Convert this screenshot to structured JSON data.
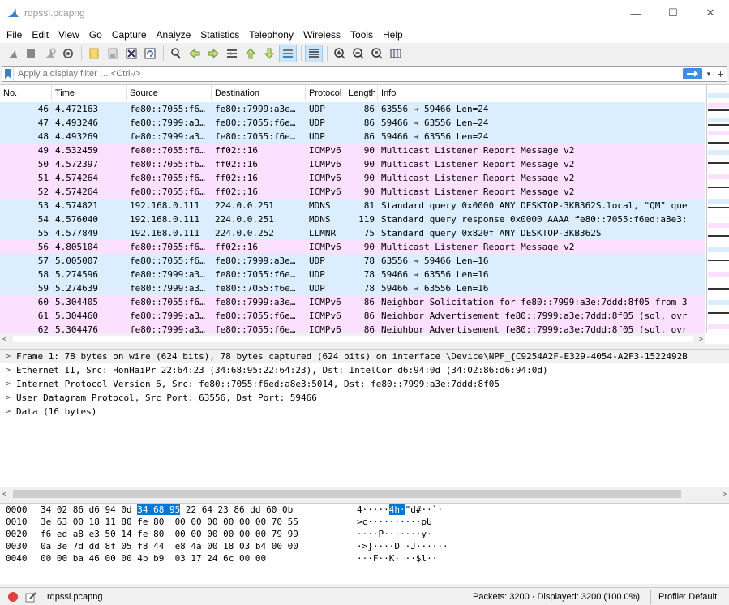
{
  "window": {
    "title": "rdpssl.pcapng",
    "min_glyph": "—",
    "max_glyph": "☐",
    "close_glyph": "✕",
    "icon": "shark-fin-icon"
  },
  "menu": [
    "File",
    "Edit",
    "View",
    "Go",
    "Capture",
    "Analyze",
    "Statistics",
    "Telephony",
    "Wireless",
    "Tools",
    "Help"
  ],
  "filter": {
    "placeholder": "Apply a display filter … <Ctrl-/>",
    "dropdown_glyph": "▾",
    "plus_glyph": "+"
  },
  "packet_list": {
    "columns": [
      "No.",
      "Time",
      "Source",
      "Destination",
      "Protocol",
      "Length",
      "Info"
    ],
    "rows": [
      {
        "no": "46",
        "time": "4.472163",
        "src": "fe80::7055:f6…",
        "dst": "fe80::7999:a3e…",
        "proto": "UDP",
        "len": "86",
        "info": "63556 → 59466 Len=24",
        "kind": "udp"
      },
      {
        "no": "47",
        "time": "4.493246",
        "src": "fe80::7999:a3…",
        "dst": "fe80::7055:f6e…",
        "proto": "UDP",
        "len": "86",
        "info": "59466 → 63556 Len=24",
        "kind": "udp"
      },
      {
        "no": "48",
        "time": "4.493269",
        "src": "fe80::7999:a3…",
        "dst": "fe80::7055:f6e…",
        "proto": "UDP",
        "len": "86",
        "info": "59466 → 63556 Len=24",
        "kind": "udp"
      },
      {
        "no": "49",
        "time": "4.532459",
        "src": "fe80::7055:f6…",
        "dst": "ff02::16",
        "proto": "ICMPv6",
        "len": "90",
        "info": "Multicast Listener Report Message v2",
        "kind": "icmp"
      },
      {
        "no": "50",
        "time": "4.572397",
        "src": "fe80::7055:f6…",
        "dst": "ff02::16",
        "proto": "ICMPv6",
        "len": "90",
        "info": "Multicast Listener Report Message v2",
        "kind": "icmp"
      },
      {
        "no": "51",
        "time": "4.574264",
        "src": "fe80::7055:f6…",
        "dst": "ff02::16",
        "proto": "ICMPv6",
        "len": "90",
        "info": "Multicast Listener Report Message v2",
        "kind": "icmp"
      },
      {
        "no": "52",
        "time": "4.574264",
        "src": "fe80::7055:f6…",
        "dst": "ff02::16",
        "proto": "ICMPv6",
        "len": "90",
        "info": "Multicast Listener Report Message v2",
        "kind": "icmp"
      },
      {
        "no": "53",
        "time": "4.574821",
        "src": "192.168.0.111",
        "dst": "224.0.0.251",
        "proto": "MDNS",
        "len": "81",
        "info": "Standard query 0x0000 ANY DESKTOP-3KB362S.local, \"QM\" que",
        "kind": "udp"
      },
      {
        "no": "54",
        "time": "4.576040",
        "src": "192.168.0.111",
        "dst": "224.0.0.251",
        "proto": "MDNS",
        "len": "119",
        "info": "Standard query response 0x0000 AAAA fe80::7055:f6ed:a8e3:",
        "kind": "udp"
      },
      {
        "no": "55",
        "time": "4.577849",
        "src": "192.168.0.111",
        "dst": "224.0.0.252",
        "proto": "LLMNR",
        "len": "75",
        "info": "Standard query 0x820f ANY DESKTOP-3KB362S",
        "kind": "udp"
      },
      {
        "no": "56",
        "time": "4.805104",
        "src": "fe80::7055:f6…",
        "dst": "ff02::16",
        "proto": "ICMPv6",
        "len": "90",
        "info": "Multicast Listener Report Message v2",
        "kind": "icmp"
      },
      {
        "no": "57",
        "time": "5.005007",
        "src": "fe80::7055:f6…",
        "dst": "fe80::7999:a3e…",
        "proto": "UDP",
        "len": "78",
        "info": "63556 → 59466 Len=16",
        "kind": "udp"
      },
      {
        "no": "58",
        "time": "5.274596",
        "src": "fe80::7999:a3…",
        "dst": "fe80::7055:f6e…",
        "proto": "UDP",
        "len": "78",
        "info": "59466 → 63556 Len=16",
        "kind": "udp"
      },
      {
        "no": "59",
        "time": "5.274639",
        "src": "fe80::7999:a3…",
        "dst": "fe80::7055:f6e…",
        "proto": "UDP",
        "len": "78",
        "info": "59466 → 63556 Len=16",
        "kind": "udp"
      },
      {
        "no": "60",
        "time": "5.304405",
        "src": "fe80::7055:f6…",
        "dst": "fe80::7999:a3e…",
        "proto": "ICMPv6",
        "len": "86",
        "info": "Neighbor Solicitation for fe80::7999:a3e:7ddd:8f05 from 3",
        "kind": "icmp"
      },
      {
        "no": "61",
        "time": "5.304460",
        "src": "fe80::7999:a3…",
        "dst": "fe80::7055:f6e…",
        "proto": "ICMPv6",
        "len": "86",
        "info": "Neighbor Advertisement fe80::7999:a3e:7ddd:8f05 (sol, ovr",
        "kind": "icmp"
      },
      {
        "no": "62",
        "time": "5.304476",
        "src": "fe80::7999:a3…",
        "dst": "fe80::7055:f6e…",
        "proto": "ICMPv6",
        "len": "86",
        "info": "Neighbor Advertisement fe80::7999:a3e:7ddd:8f05 (sol, ovr",
        "kind": "icmp"
      }
    ],
    "scroll_left": "<",
    "scroll_right": ">"
  },
  "details": {
    "expander_glyph": ">",
    "lines": [
      "Frame 1: 78 bytes on wire (624 bits), 78 bytes captured (624 bits) on interface \\Device\\NPF_{C9254A2F-E329-4054-A2F3-1522492B",
      "Ethernet II, Src: HonHaiPr_22:64:23 (34:68:95:22:64:23), Dst: IntelCor_d6:94:0d (34:02:86:d6:94:0d)",
      "Internet Protocol Version 6, Src: fe80::7055:f6ed:a8e3:5014, Dst: fe80::7999:a3e:7ddd:8f05",
      "User Datagram Protocol, Src Port: 63556, Dst Port: 59466",
      "Data (16 bytes)"
    ],
    "scroll_left": "<",
    "scroll_right": ">"
  },
  "bytes": {
    "lines": [
      {
        "off": "0000",
        "hex_pre": "34 02 86 d6 94 0d ",
        "hex_hl": "34 68 95",
        "hex_post": " 22 64 23 86 dd 60 0b",
        "asc_pre": "4·····",
        "asc_hl": "4h·",
        "asc_post": "\"d#··`·"
      },
      {
        "off": "0010",
        "hex_pre": "3e 63 00 18 11 80 fe 80  00 00 00 00 00 00 70 55",
        "hex_hl": "",
        "hex_post": "",
        "asc_pre": ">c··········pU",
        "asc_hl": "",
        "asc_post": ""
      },
      {
        "off": "0020",
        "hex_pre": "f6 ed a8 e3 50 14 fe 80  00 00 00 00 00 00 79 99",
        "hex_hl": "",
        "hex_post": "",
        "asc_pre": "····P·······y·",
        "asc_hl": "",
        "asc_post": ""
      },
      {
        "off": "0030",
        "hex_pre": "0a 3e 7d dd 8f 05 f8 44  e8 4a 00 18 03 b4 00 00",
        "hex_hl": "",
        "hex_post": "",
        "asc_pre": "·>}····D ·J······",
        "asc_hl": "",
        "asc_post": ""
      },
      {
        "off": "0040",
        "hex_pre": "00 00 ba 46 00 00 4b b9  03 17 24 6c 00 00",
        "hex_hl": "",
        "hex_post": "",
        "asc_pre": "···F··K· ··$l··",
        "asc_hl": "",
        "asc_post": ""
      }
    ]
  },
  "status": {
    "file": "rdpssl.pcapng",
    "packets": "Packets: 3200 · Displayed: 3200 (100.0%)",
    "profile": "Profile: Default"
  },
  "colors": {
    "udp_row": "#daeeff",
    "icmp_row": "#fce0ff",
    "selection": "#0078d7",
    "apply_arrow": "#3f8ee6"
  },
  "toolbar_icons": [
    "shark-fin-start-icon",
    "stop-icon",
    "restart-icon",
    "options-gear-icon",
    "open-file-icon",
    "save-file-icon",
    "close-file-icon",
    "reload-icon",
    "find-icon",
    "go-back-icon",
    "go-forward-icon",
    "go-to-packet-icon",
    "first-packet-icon",
    "last-packet-icon",
    "autoscroll-icon",
    "colorize-icon",
    "zoom-in-icon",
    "zoom-out-icon",
    "zoom-normal-icon",
    "resize-columns-icon"
  ]
}
